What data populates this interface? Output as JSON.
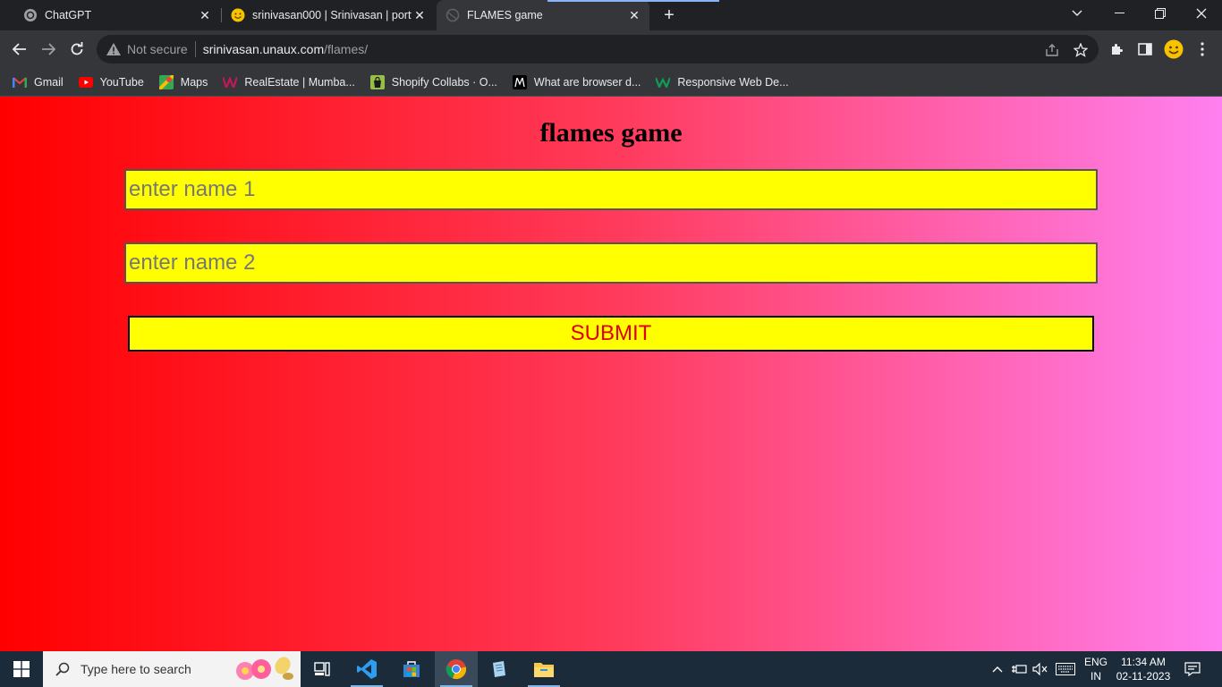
{
  "browser": {
    "tabs": [
      {
        "title": "ChatGPT",
        "icon": "openai-icon",
        "active": false
      },
      {
        "title": "srinivasan000 | Srinivasan | portfo",
        "icon": "smiley-icon",
        "active": false
      },
      {
        "title": "FLAMES game",
        "icon": "globe-icon",
        "active": true
      }
    ],
    "new_tab_label": "+",
    "omnibox": {
      "security_label": "Not secure",
      "host": "srinivasan.unaux.com",
      "path": "/flames/"
    },
    "bookmarks": [
      {
        "label": "Gmail",
        "icon": "gmail-icon",
        "color": "#ea4335"
      },
      {
        "label": "YouTube",
        "icon": "youtube-icon",
        "color": "#ff0000"
      },
      {
        "label": "Maps",
        "icon": "maps-icon",
        "color": "#34a853"
      },
      {
        "label": "RealEstate | Mumba...",
        "icon": "realestate-icon",
        "color": "#c2185b"
      },
      {
        "label": "Shopify Collabs · O...",
        "icon": "shopify-icon",
        "color": "#95bf47"
      },
      {
        "label": "What are browser d...",
        "icon": "medium-icon",
        "color": "#000000"
      },
      {
        "label": "Responsive Web De...",
        "icon": "w-icon",
        "color": "#0f9d58"
      }
    ]
  },
  "page": {
    "title": "flames game",
    "name1_placeholder": "enter name 1",
    "name2_placeholder": "enter name 2",
    "submit_label": "SUBMIT",
    "colors": {
      "gradient_start": "#ff0000",
      "gradient_end": "#ff80f0",
      "field_bg": "#ffff00",
      "submit_text": "#e00000"
    }
  },
  "taskbar": {
    "search_placeholder": "Type here to search",
    "language": "ENG",
    "region": "IN",
    "time": "11:34 AM",
    "date": "02-11-2023"
  }
}
